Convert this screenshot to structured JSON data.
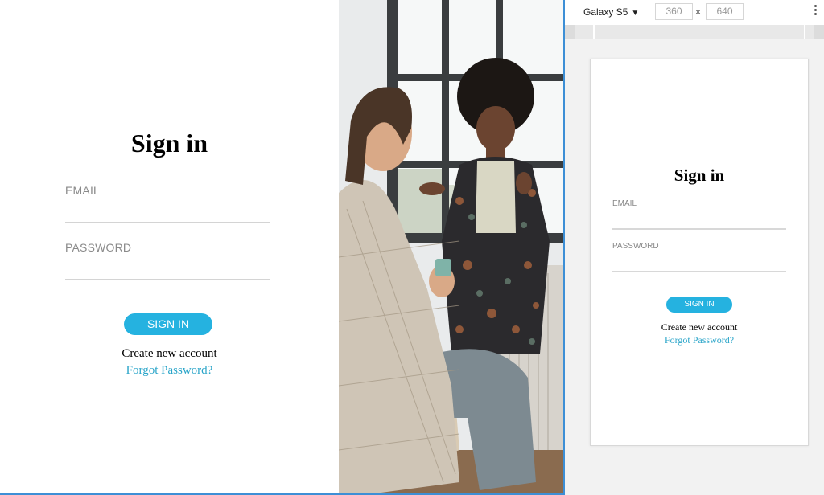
{
  "page": {
    "title": "Sign in",
    "email_label": "EMAIL",
    "password_label": "PASSWORD",
    "signin_button": "SIGN IN",
    "create_account": "Create new account",
    "forgot_password": "Forgot Password?"
  },
  "devtools": {
    "device_name": "Galaxy S5",
    "width": "360",
    "height": "640",
    "separator": "×",
    "dropdown_caret": "▼"
  },
  "colors": {
    "accent": "#25b2e0",
    "link": "#2aa5c9",
    "viewport_border": "#3d8fd6"
  },
  "icons": {
    "dropdown": "caret-down-icon",
    "more": "kebab-menu-icon",
    "photo": "people-meeting-photo"
  }
}
